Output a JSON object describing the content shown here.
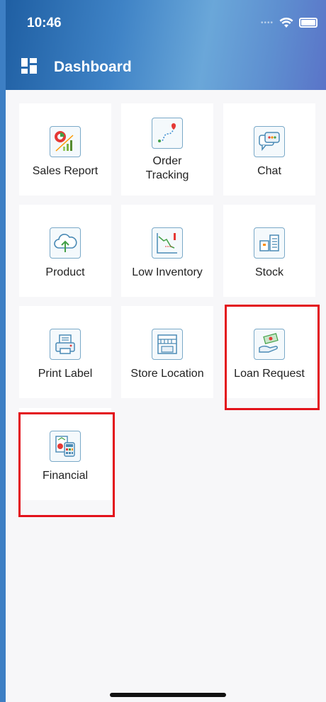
{
  "status_bar": {
    "time": "10:46"
  },
  "header": {
    "title": "Dashboard"
  },
  "tiles": [
    {
      "label": "Sales Report",
      "icon": "sales-report-icon"
    },
    {
      "label": "Order\nTracking",
      "icon": "order-tracking-icon"
    },
    {
      "label": "Chat",
      "icon": "chat-icon"
    },
    {
      "label": "Product",
      "icon": "product-cloud-icon"
    },
    {
      "label": "Low Inventory",
      "icon": "low-inventory-icon"
    },
    {
      "label": "Stock",
      "icon": "stock-icon"
    },
    {
      "label": "Print Label",
      "icon": "printer-icon"
    },
    {
      "label": "Store Location",
      "icon": "store-icon"
    },
    {
      "label": "Loan Request",
      "icon": "loan-hand-icon"
    },
    {
      "label": "Financial",
      "icon": "financial-calculator-icon"
    }
  ],
  "colors": {
    "header_start": "#1f5fa3",
    "header_end": "#5a74c8",
    "highlight": "#e3121b",
    "page_bg": "#f7f7f9"
  }
}
